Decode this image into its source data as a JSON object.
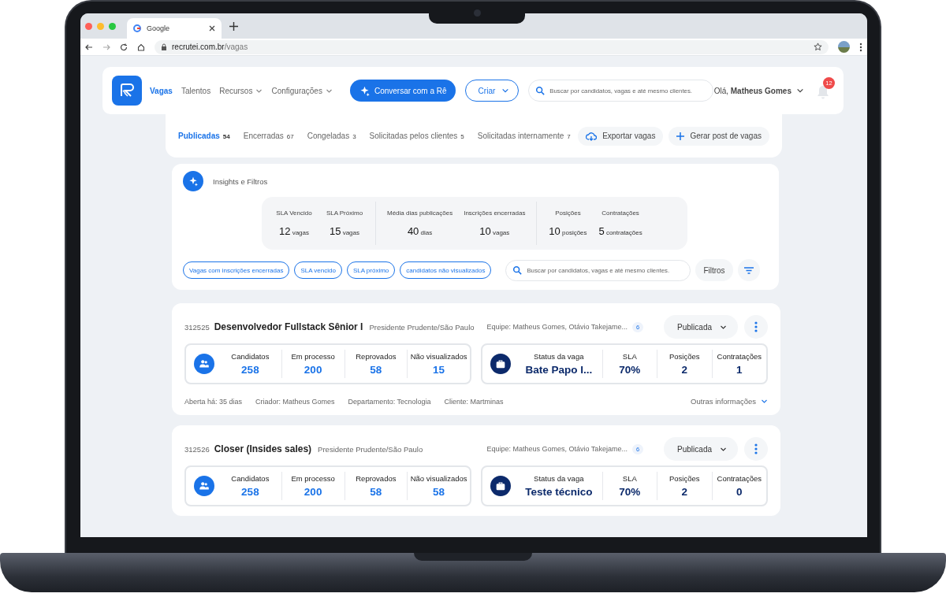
{
  "browser": {
    "tab_title": "Google",
    "url_domain": "recrutei.com.br",
    "url_path": "/vagas"
  },
  "nav": {
    "items": [
      {
        "label": "Vagas",
        "selected": true,
        "dropdown": false
      },
      {
        "label": "Talentos",
        "selected": false,
        "dropdown": false
      },
      {
        "label": "Recursos",
        "selected": false,
        "dropdown": true
      },
      {
        "label": "Configurações",
        "selected": false,
        "dropdown": true
      }
    ],
    "chat_button": "Conversar com a Rê",
    "create_button": "Criar",
    "search_placeholder": "Buscar por candidatos, vagas e até mesmo clientes.",
    "greeting": "Olá, **Matheus Gomes**",
    "notifications": "12"
  },
  "tabs": [
    {
      "label": "Publicadas",
      "count": "54",
      "selected": true
    },
    {
      "label": "Encerradas",
      "count": "67",
      "selected": false
    },
    {
      "label": "Congeladas",
      "count": "3",
      "selected": false
    },
    {
      "label": "Solicitadas pelos clientes",
      "count": "5",
      "selected": false
    },
    {
      "label": "Solicitadas internamente",
      "count": "7",
      "selected": false
    }
  ],
  "tab_actions": [
    {
      "label": "Exportar vagas",
      "kind": "export"
    },
    {
      "label": "Gerar post de vagas",
      "kind": "add"
    }
  ],
  "insights": {
    "title": "Insights e Filtros",
    "stat_groups": [
      [
        {
          "label": "SLA Vencido",
          "value": "12",
          "unit": "vagas"
        },
        {
          "label": "SLA Próximo",
          "value": "15",
          "unit": "vagas"
        }
      ],
      [
        {
          "label": "Média dias publicações",
          "value": "40",
          "unit": "dias"
        },
        {
          "label": "Inscrições encerradas",
          "value": "10",
          "unit": "vagas"
        }
      ],
      [
        {
          "label": "Posições",
          "value": "10",
          "unit": "posições"
        },
        {
          "label": "Contratações",
          "value": "5",
          "unit": "contratações"
        }
      ]
    ],
    "chips": [
      "Vagas com inscrições encerradas",
      "SLA vencido",
      "SLA próximo",
      "candidatos não visualizados"
    ],
    "search_placeholder": "Buscar por candidatos, vagas e até mesmo clientes.",
    "filter_button": "Filtros"
  },
  "jobs": [
    {
      "id": "312525",
      "title": "Desenvolvedor Fullstack Sênior I",
      "location": "Presidente Prudente/São Paulo",
      "team": "Equipe: Matheus Gomes, Otávio Takejame...",
      "team_count": "6",
      "status": "Publicada",
      "candidate_stats": [
        {
          "label": "Candidatos",
          "value": "258"
        },
        {
          "label": "Em processo",
          "value": "200"
        },
        {
          "label": "Reprovados",
          "value": "58"
        },
        {
          "label": "Não visualizados",
          "value": "15"
        }
      ],
      "job_stats": [
        {
          "label": "Status da vaga",
          "value": "Bate Papo I..."
        },
        {
          "label": "SLA",
          "value": "70%"
        },
        {
          "label": "Posições",
          "value": "2"
        },
        {
          "label": "Contratações",
          "value": "1"
        }
      ],
      "meta": [
        "Aberta há: 35 dias",
        "Criador: Matheus Gomes",
        "Departamento: Tecnologia",
        "Cliente: Martminas"
      ],
      "more": "Outras informações"
    },
    {
      "id": "312526",
      "title": "Closer (Insides sales)",
      "location": "Presidente Prudente/São Paulo",
      "team": "Equipe: Matheus Gomes, Otávio Takejame...",
      "team_count": "6",
      "status": "Publicada",
      "candidate_stats": [
        {
          "label": "Candidatos",
          "value": "258"
        },
        {
          "label": "Em processo",
          "value": "200"
        },
        {
          "label": "Reprovados",
          "value": "58"
        },
        {
          "label": "Não visualizados",
          "value": "58"
        }
      ],
      "job_stats": [
        {
          "label": "Status da vaga",
          "value": "Teste técnico"
        },
        {
          "label": "SLA",
          "value": "70%"
        },
        {
          "label": "Posições",
          "value": "2"
        },
        {
          "label": "Contratações",
          "value": "0"
        }
      ]
    }
  ]
}
